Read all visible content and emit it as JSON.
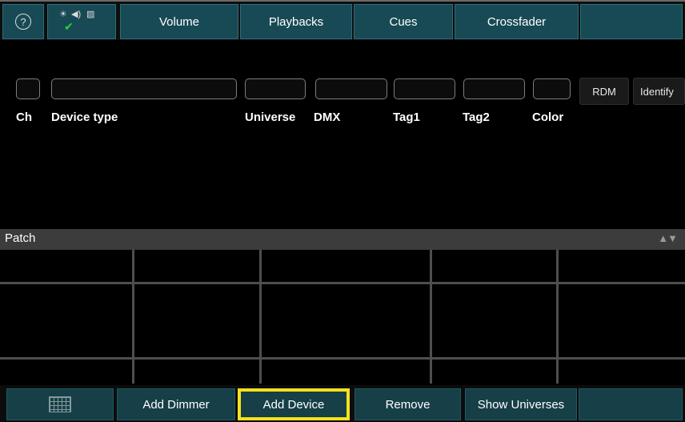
{
  "topbar": {
    "help_icon": "question-circle-icon",
    "status_icons": [
      "brightness-icon",
      "volume-icon",
      "image-icon",
      "check-icon"
    ],
    "tabs": [
      {
        "label": "Volume"
      },
      {
        "label": "Playbacks"
      },
      {
        "label": "Cues"
      },
      {
        "label": "Crossfader"
      }
    ]
  },
  "filters": {
    "rdm_label": "RDM",
    "identify_label": "Identify"
  },
  "columns": {
    "ch": "Ch",
    "device_type": "Device type",
    "universe": "Universe",
    "dmx": "DMX",
    "tag1": "Tag1",
    "tag2": "Tag2",
    "color": "Color"
  },
  "patch": {
    "title": "Patch",
    "sort_icon": "up-down-arrows-icon"
  },
  "bottombar": {
    "grid_icon": "grid-icon",
    "add_dimmer": "Add Dimmer",
    "add_device": "Add Device",
    "remove": "Remove",
    "show_universes": "Show Universes",
    "highlight_color": "#f5e21b"
  },
  "colors": {
    "tab_bg": "#174a55",
    "button_bg": "#163f47",
    "panel_bar": "#3c3c3c"
  }
}
